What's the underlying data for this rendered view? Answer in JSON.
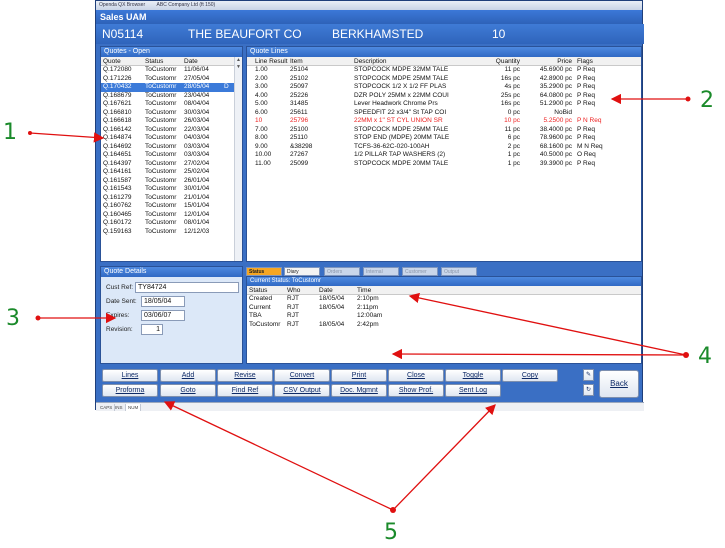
{
  "window": {
    "titlebar": [
      "Openda QX Browser",
      "ABC Company Ltd (ft 150)"
    ],
    "app_title": "Sales UAM"
  },
  "customer": {
    "code": "N05114",
    "name": "THE BEAUFORT CO",
    "town": "BERKHAMSTED",
    "value": "10"
  },
  "quotes": {
    "title": "Quotes - Open",
    "headers": [
      "Quote",
      "Status",
      "Date"
    ],
    "rows": [
      [
        "Q.172080",
        "ToCustomr",
        "11/06/04",
        ""
      ],
      [
        "Q.171226",
        "ToCustomr",
        "27/05/04",
        ""
      ],
      [
        "Q.170432",
        "ToCustomr",
        "28/05/04",
        "D"
      ],
      [
        "Q.168679",
        "ToCustomr",
        "23/04/04",
        ""
      ],
      [
        "Q.167621",
        "ToCustomr",
        "08/04/04",
        ""
      ],
      [
        "Q.166810",
        "ToCustomr",
        "30/03/04",
        ""
      ],
      [
        "Q.166618",
        "ToCustomr",
        "26/03/04",
        ""
      ],
      [
        "Q.166142",
        "ToCustomr",
        "22/03/04",
        ""
      ],
      [
        "Q.164874",
        "ToCustomr",
        "04/03/04",
        ""
      ],
      [
        "Q.164692",
        "ToCustomr",
        "03/03/04",
        ""
      ],
      [
        "Q.164651",
        "ToCustomr",
        "03/03/04",
        ""
      ],
      [
        "Q.164397",
        "ToCustomr",
        "27/02/04",
        ""
      ],
      [
        "Q.164161",
        "ToCustomr",
        "25/02/04",
        ""
      ],
      [
        "Q.161587",
        "ToCustomr",
        "26/01/04",
        ""
      ],
      [
        "Q.161543",
        "ToCustomr",
        "30/01/04",
        ""
      ],
      [
        "Q.161279",
        "ToCustomr",
        "21/01/04",
        ""
      ],
      [
        "Q.160762",
        "ToCustomr",
        "15/01/04",
        ""
      ],
      [
        "Q.160465",
        "ToCustomr",
        "12/01/04",
        ""
      ],
      [
        "Q.160172",
        "ToCustomr",
        "08/01/04",
        ""
      ],
      [
        "Q.159163",
        "ToCustomr",
        "12/12/03",
        ""
      ]
    ],
    "selected_index": 2
  },
  "quote_lines": {
    "title": "Quote Lines",
    "headers": [
      "Line Result",
      "Item",
      "Description",
      "Quantity",
      "Price",
      "Flags"
    ],
    "rows": [
      [
        "1.00",
        "25104",
        "STOPCOCK MDPE 32MM TALE",
        "11 pc",
        "45.6900 pc",
        "P  Req"
      ],
      [
        "2.00",
        "25102",
        "STOPCOCK MDPE 25MM TALE",
        "16s pc",
        "42.8900 pc",
        "P  Req"
      ],
      [
        "3.00",
        "25097",
        "STOPCOCK 1/2 X 1/2 FF PLAS",
        "4s pc",
        "35.2900 pc",
        "P  Req"
      ],
      [
        "4.00",
        "25226",
        "DZR POLY 25MM x 22MM COUI",
        "25s pc",
        "64.0800 pc",
        "P  Req"
      ],
      [
        "5.00",
        "31485",
        "Lever Headwork Chrome Prs",
        "16s pc",
        "51.2900 pc",
        "P  Req"
      ],
      [
        "6.00",
        "25611",
        "SPEEDFIT 22 x3/4\" St TAP COI",
        "0 pc",
        "NoBid",
        ""
      ],
      [
        "10",
        "25796",
        "22MM x 1\" ST CYL UNION   SR",
        "10 pc",
        "5.2500 pc",
        "P N  Req"
      ],
      [
        "7.00",
        "25100",
        "STOPCOCK MDPE 25MM TALE",
        "11 pc",
        "38.4000 pc",
        "P  Req"
      ],
      [
        "8.00",
        "25110",
        "STOP END (MDPE) 20MM TALE",
        "6 pc",
        "78.9600 pc",
        "P  Req"
      ],
      [
        "9.00",
        "&38298",
        "TCFS-36-62C-020-100AH",
        "2 pc",
        "68.1600 pc",
        "M N  Req"
      ],
      [
        "10.00",
        "27267",
        "1/2 PILLAR TAP WASHERS (2)",
        "1 pc",
        "40.5000 pc",
        "O  Req"
      ],
      [
        "11.00",
        "25099",
        "STOPCOCK MDPE 20MM TALE",
        "1 pc",
        "39.3900 pc",
        "P  Req"
      ]
    ],
    "red_row_index": 6
  },
  "details": {
    "title": "Quote Details",
    "cust_ref_label": "Cust Ref:",
    "cust_ref": "TY84724",
    "date_sent_label": "Date Sent:",
    "date_sent": "18/05/04",
    "expires_label": "Expires:",
    "expires": "03/06/07",
    "revision_label": "Revision:",
    "revision": "1"
  },
  "tabs": [
    "Status",
    "Diary",
    "Orders",
    "Internal",
    "Customer",
    "Output"
  ],
  "status": {
    "title": "Current Status: ToCustomr",
    "headers": [
      "Status",
      "Who",
      "Date",
      "Time"
    ],
    "rows": [
      [
        "Created",
        "RJT",
        "18/05/04",
        "2:10pm"
      ],
      [
        "Current",
        "RJT",
        "18/05/04",
        "2:11pm"
      ],
      [
        "TBA",
        "RJT",
        "",
        "12:00am"
      ],
      [
        "ToCustomr",
        "RJT",
        "18/05/04",
        "2:42pm"
      ]
    ]
  },
  "buttons": {
    "row1": [
      "Lines",
      "Add",
      "Revise",
      "Convert",
      "Print",
      "Close",
      "Toggle",
      "Copy"
    ],
    "row2": [
      "Proforma",
      "Goto",
      "Find Ref",
      "CSV Output",
      "Doc. Mgmnt",
      "Show Prof.",
      "Sent Log"
    ],
    "back": "Back"
  },
  "status_strip": [
    "CAPS",
    "INS",
    "NUM"
  ],
  "annotations": [
    "1",
    "2",
    "3",
    "4",
    "5"
  ],
  "colors": {
    "annotation": "#1a8a2a",
    "arrow": "#e01010",
    "accent": "#3a6fc4",
    "selected": "#3b7ad9",
    "active_tab": "#f5a623"
  }
}
